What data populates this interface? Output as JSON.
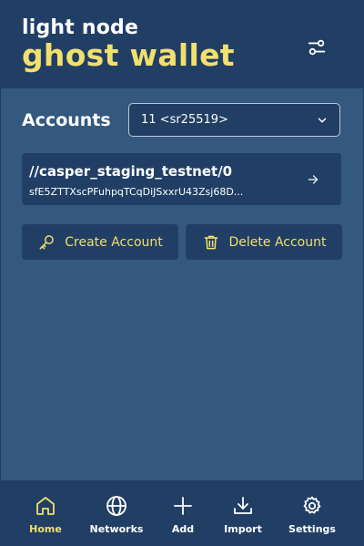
{
  "header": {
    "title_top": "light node",
    "title_main": "ghost wallet",
    "settings_icon": "sliders-icon"
  },
  "accounts": {
    "label": "Accounts",
    "selected_value": "11 <sr25519>",
    "current_account": {
      "path": "//casper_staging_testnet/0",
      "address": "sfE5ZTTXscPFuhpqTCqDiJSxxrU43Zsj68D..."
    }
  },
  "actions": {
    "create_label": "Create Account",
    "delete_label": "Delete Account"
  },
  "nav": {
    "items": [
      {
        "label": "Home",
        "icon": "home-icon",
        "active": true
      },
      {
        "label": "Networks",
        "icon": "globe-icon",
        "active": false
      },
      {
        "label": "Add",
        "icon": "plus-icon",
        "active": false
      },
      {
        "label": "Import",
        "icon": "download-icon",
        "active": false
      },
      {
        "label": "Settings",
        "icon": "gear-icon",
        "active": false
      }
    ]
  },
  "colors": {
    "background": "#35587f",
    "panel": "#213f65",
    "accent": "#f2df6d",
    "text": "#ffffff"
  }
}
